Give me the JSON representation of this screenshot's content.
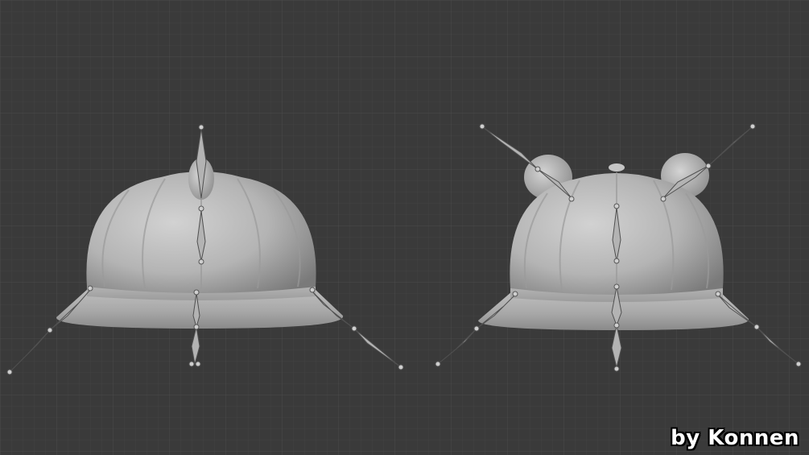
{
  "watermark": {
    "text": "by Konnen"
  },
  "colors": {
    "background": "#3a3a3a",
    "grid_minor": "#424242",
    "grid_major": "#4a4a4a",
    "mesh_light": "#cfcfcf",
    "mesh_mid": "#a6a6a6",
    "mesh_dark": "#6e6e6e",
    "bone": "#b5b5b5",
    "bone_outline": "#555555",
    "joint": "#cccccc"
  },
  "icons": [
    "helmet-mesh",
    "bone"
  ],
  "models": [
    {
      "name": "helmet-front",
      "has_ears": false
    },
    {
      "name": "helmet-bear-ears",
      "has_ears": true
    }
  ]
}
